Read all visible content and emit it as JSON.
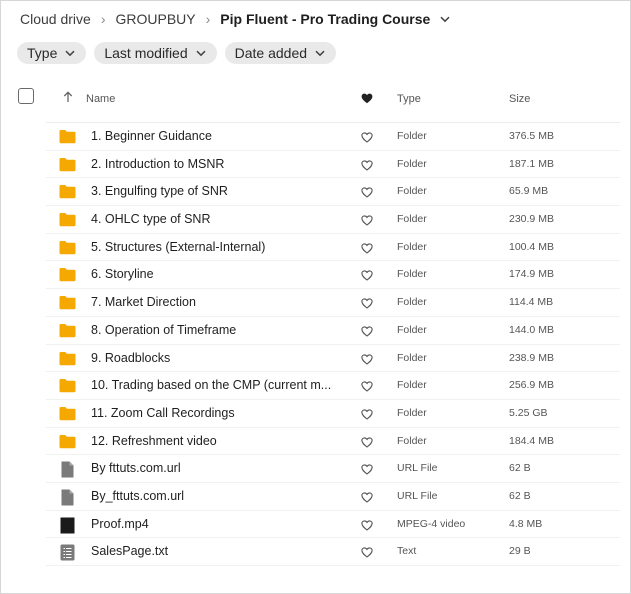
{
  "breadcrumb": {
    "items": [
      "Cloud drive",
      "GROUPBUY"
    ],
    "current": "Pip Fluent - Pro Trading Course"
  },
  "filters": [
    "Type",
    "Last modified",
    "Date added"
  ],
  "columns": {
    "name": "Name",
    "type": "Type",
    "size": "Size"
  },
  "rows": [
    {
      "name": "1. Beginner Guidance",
      "type": "Folder",
      "size": "376.5 MB",
      "icon": "folder-icon"
    },
    {
      "name": "2. Introduction to MSNR",
      "type": "Folder",
      "size": "187.1 MB",
      "icon": "folder-icon"
    },
    {
      "name": "3. Engulfing type of SNR",
      "type": "Folder",
      "size": "65.9 MB",
      "icon": "folder-icon"
    },
    {
      "name": "4. OHLC type of SNR",
      "type": "Folder",
      "size": "230.9 MB",
      "icon": "folder-icon"
    },
    {
      "name": "5. Structures (External-Internal)",
      "type": "Folder",
      "size": "100.4 MB",
      "icon": "folder-icon"
    },
    {
      "name": "6. Storyline",
      "type": "Folder",
      "size": "174.9 MB",
      "icon": "folder-icon"
    },
    {
      "name": "7. Market Direction",
      "type": "Folder",
      "size": "114.4 MB",
      "icon": "folder-icon"
    },
    {
      "name": "8. Operation of Timeframe",
      "type": "Folder",
      "size": "144.0 MB",
      "icon": "folder-icon"
    },
    {
      "name": "9. Roadblocks",
      "type": "Folder",
      "size": "238.9 MB",
      "icon": "folder-icon"
    },
    {
      "name": "10. Trading based on the CMP (current m...",
      "type": "Folder",
      "size": "256.9 MB",
      "icon": "folder-icon"
    },
    {
      "name": "11. Zoom Call Recordings",
      "type": "Folder",
      "size": "5.25 GB",
      "icon": "folder-icon"
    },
    {
      "name": "12. Refreshment video",
      "type": "Folder",
      "size": "184.4 MB",
      "icon": "folder-icon"
    },
    {
      "name": "By fttuts.com.url",
      "type": "URL File",
      "size": "62 B",
      "icon": "file-icon"
    },
    {
      "name": "By_fttuts.com.url",
      "type": "URL File",
      "size": "62 B",
      "icon": "file-icon"
    },
    {
      "name": "Proof.mp4",
      "type": "MPEG-4 video",
      "size": "4.8 MB",
      "icon": "video-icon"
    },
    {
      "name": "SalesPage.txt",
      "type": "Text",
      "size": "29 B",
      "icon": "text-file-icon"
    }
  ],
  "colors": {
    "folder": "#f5a800",
    "file": "#7a7a7a",
    "video": "#1a1a1a"
  }
}
